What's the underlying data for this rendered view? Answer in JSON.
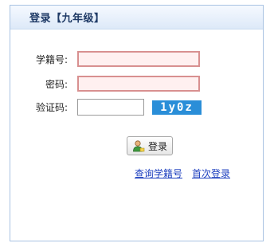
{
  "panel": {
    "title": "登录【九年级】"
  },
  "form": {
    "student_id_label": "学籍号:",
    "student_id_value": "",
    "password_label": "密码:",
    "password_value": "",
    "captcha_label": "验证码:",
    "captcha_value": "",
    "captcha_text": "1y0z"
  },
  "actions": {
    "login_label": "登录",
    "query_link": "查询学籍号",
    "first_login_link": "首次登录"
  },
  "colors": {
    "header_bg": "#dde9f8",
    "field_border": "#d89090",
    "field_bg": "#fff0f0",
    "captcha_bg": "#2a8ed8",
    "link": "#1d3fbf"
  }
}
